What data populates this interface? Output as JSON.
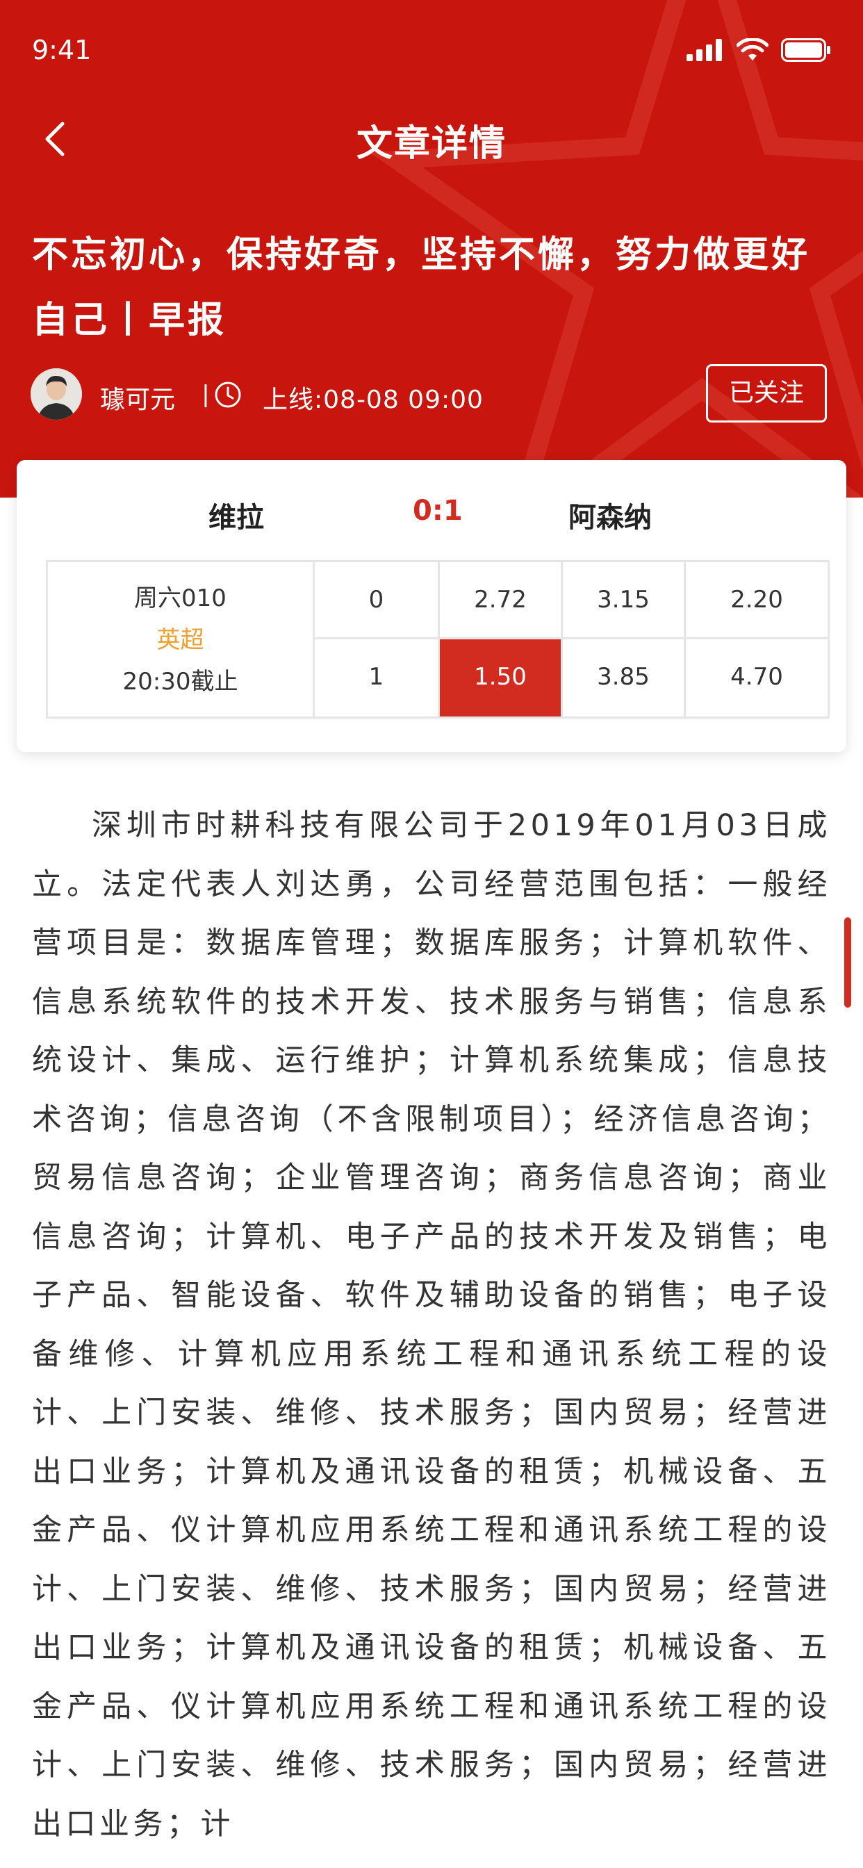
{
  "status_bar": {
    "time": "9:41"
  },
  "nav": {
    "title": "文章详情"
  },
  "article": {
    "title": "不忘初心，保持好奇，坚持不懈，努力做更好自己丨早报",
    "author": "璩可元",
    "separator": "丨",
    "online_time": "上线:08-08 09:00",
    "follow_label": "已关注"
  },
  "match": {
    "home_team": "维拉",
    "score": "0:1",
    "away_team": "阿森纳",
    "match_code": "周六010",
    "league": "英超",
    "deadline": "20:30截止",
    "rows": [
      {
        "handicap": "0",
        "odds": [
          "2.72",
          "3.15",
          "2.20"
        ]
      },
      {
        "handicap": "1",
        "odds": [
          "1.50",
          "3.85",
          "4.70"
        ]
      }
    ]
  },
  "body": {
    "paragraph": "深圳市时耕科技有限公司于2019年01月03日成立。法定代表人刘达勇，公司经营范围包括：一般经营项目是：数据库管理；数据库服务；计算机软件、信息系统软件的技术开发、技术服务与销售；信息系统设计、集成、运行维护；计算机系统集成；信息技术咨询；信息咨询（不含限制项目）；经济信息咨询；贸易信息咨询；企业管理咨询；商务信息咨询；商业信息咨询；计算机、电子产品的技术开发及销售；电子产品、智能设备、软件及辅助设备的销售；电子设备维修、计算机应用系统工程和通讯系统工程的设计、上门安装、维修、技术服务；国内贸易；经营进出口业务；计算机及通讯设备的租赁；机械设备、五金产品、仪计算机应用系统工程和通讯系统工程的设计、上门安装、维修、技术服务；国内贸易；经营进出口业务；计算机及通讯设备的租赁；机械设备、五金产品、仪计算机应用系统工程和通讯系统工程的设计、上门安装、维修、技术服务；国内贸易；经营进出口业务；计"
  },
  "colors": {
    "brand_red": "#c8160e",
    "accent_red": "#d22b20",
    "league_orange": "#f0a030"
  }
}
